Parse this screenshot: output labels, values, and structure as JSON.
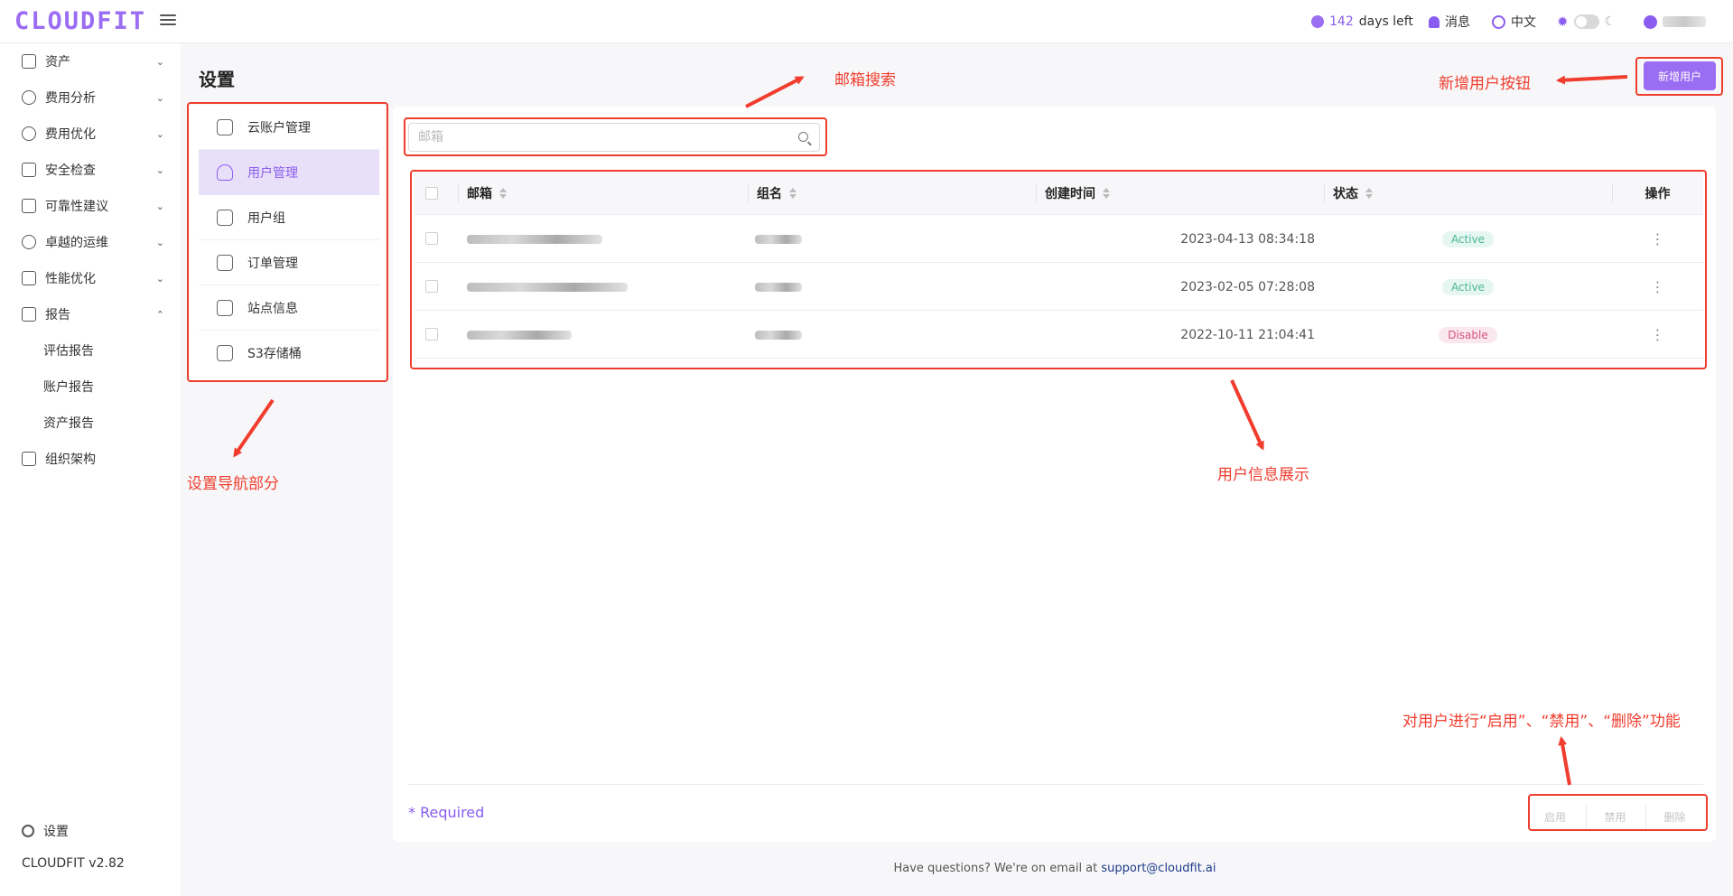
{
  "topbar": {
    "logo": "CLOUDFIT",
    "days_num": "142",
    "days_text": "days left",
    "messages": "消息",
    "language": "中文"
  },
  "sidebar": {
    "items": [
      {
        "label": "资产",
        "icon": "asset-icon"
      },
      {
        "label": "费用分析",
        "icon": "cost-analysis-icon"
      },
      {
        "label": "费用优化",
        "icon": "dollar-icon"
      },
      {
        "label": "安全检查",
        "icon": "alarm-icon"
      },
      {
        "label": "可靠性建议",
        "icon": "reliability-icon"
      },
      {
        "label": "卓越的运维",
        "icon": "cloud-ops-icon"
      },
      {
        "label": "性能优化",
        "icon": "performance-icon"
      },
      {
        "label": "报告",
        "icon": "report-icon"
      }
    ],
    "report_subitems": [
      "评估报告",
      "账户报告",
      "资产报告"
    ],
    "org": "组织架构",
    "settings": "设置",
    "version": "CLOUDFIT v2.82"
  },
  "page": {
    "title": "设置",
    "new_user_button": "新增用户"
  },
  "settings_nav": {
    "items": [
      "云账户管理",
      "用户管理",
      "用户组",
      "订单管理",
      "站点信息",
      "S3存储桶"
    ],
    "active_index": 1
  },
  "search": {
    "placeholder": "邮箱"
  },
  "table": {
    "columns": [
      "邮箱",
      "组名",
      "创建时间",
      "状态",
      "操作"
    ],
    "rows": [
      {
        "created": "2023-04-13 08:34:18",
        "status": "Active"
      },
      {
        "created": "2023-02-05 07:28:08",
        "status": "Active"
      },
      {
        "created": "2022-10-11 21:04:41",
        "status": "Disable"
      }
    ]
  },
  "footer": {
    "required": "* Required",
    "actions": [
      "启用",
      "禁用",
      "删除"
    ],
    "question": "Have questions? We're on email at",
    "email": "support@cloudfit.ai"
  },
  "annotations": {
    "email_search": "邮箱搜索",
    "new_user_button": "新增用户按钮",
    "settings_nav": "设置导航部分",
    "user_info": "用户信息展示",
    "user_actions": "对用户进行“启用”、“禁用”、“删除”功能"
  },
  "colors": {
    "accent": "#9b6df2",
    "annotation": "#f03d2e",
    "active_badge": "#49b79a",
    "disable_badge": "#d8557c"
  }
}
